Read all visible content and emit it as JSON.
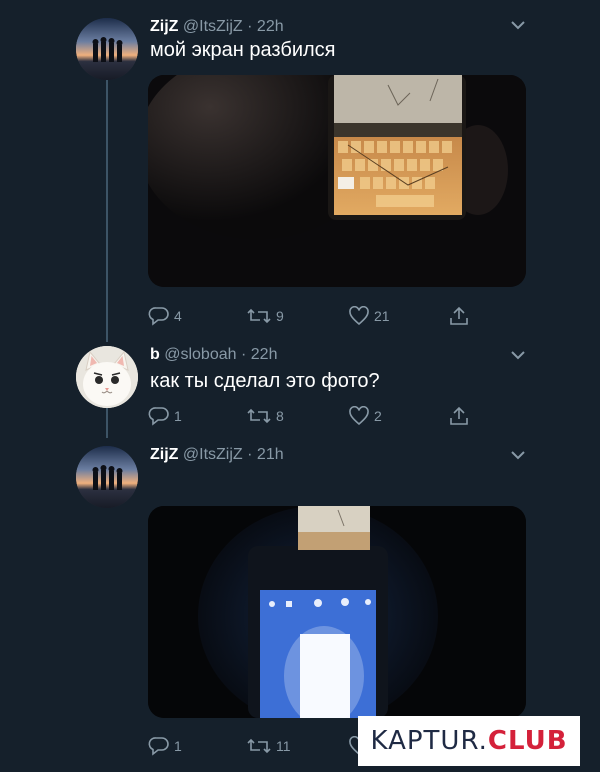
{
  "tweets": [
    {
      "name": "ZijZ",
      "handle": "@ItsZijZ",
      "separator": "·",
      "time": "22h",
      "text": "мой экран разбился",
      "media": "photo",
      "replies": "4",
      "retweets": "9",
      "likes": "21",
      "avatar": "sunset-group-avatar"
    },
    {
      "name": "b",
      "handle": "@sloboah",
      "separator": "·",
      "time": "22h",
      "text": "как ты сделал это фото?",
      "replies": "1",
      "retweets": "8",
      "likes": "2",
      "avatar": "cat-avatar"
    },
    {
      "name": "ZijZ",
      "handle": "@ItsZijZ",
      "separator": "·",
      "time": "21h",
      "media": "photo",
      "replies": "1",
      "retweets": "11",
      "avatar": "sunset-group-avatar"
    }
  ],
  "watermark": {
    "part1": "KAPTUR.",
    "part2": "CLUB"
  },
  "colors": {
    "background": "#15202b",
    "muted": "#8899a6",
    "thread": "#3d5466"
  }
}
